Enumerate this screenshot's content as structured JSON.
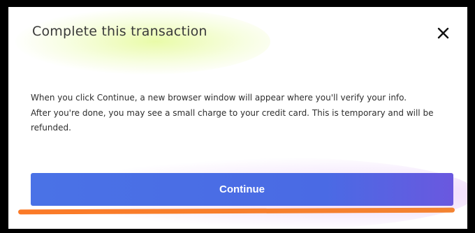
{
  "dialog": {
    "title": "Complete this transaction",
    "close_icon": "close-icon",
    "body_lines": [
      "When you click Continue, a new browser window will appear where you'll verify your info.",
      "After you're done, you may see a small charge to your credit card. This is temporary and will be refunded."
    ],
    "continue_label": "Continue"
  },
  "colors": {
    "button": "#4a6ae4",
    "annotation_underline": "#f7802d",
    "title_highlight": "#e2fa8c"
  }
}
